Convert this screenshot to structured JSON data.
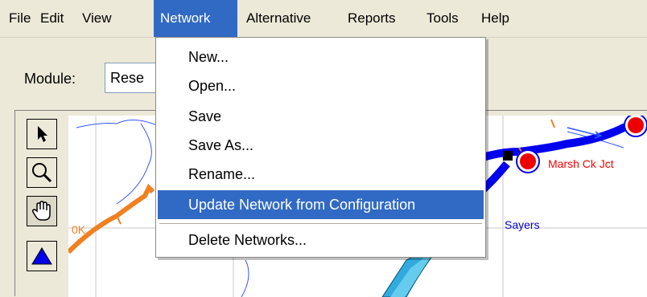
{
  "menubar": {
    "items": [
      {
        "label": "File"
      },
      {
        "label": "Edit"
      },
      {
        "label": "View"
      },
      {
        "label": "Network"
      },
      {
        "label": "Alternative"
      },
      {
        "label": "Reports"
      },
      {
        "label": "Tools"
      },
      {
        "label": "Help"
      }
    ],
    "active": "Network"
  },
  "module": {
    "label": "Module:",
    "value": "Rese"
  },
  "network_menu": {
    "items": [
      {
        "label": "New..."
      },
      {
        "label": "Open..."
      },
      {
        "label": "Save"
      },
      {
        "label": "Save As..."
      },
      {
        "label": "Rename..."
      },
      {
        "label": "Update Network from Configuration"
      },
      {
        "label": "Delete Networks..."
      }
    ],
    "highlighted": "Update Network from Configuration"
  },
  "toolbox": {
    "tools": [
      {
        "icon": "arrow-pointer-icon"
      },
      {
        "icon": "magnifier-icon"
      },
      {
        "icon": "hand-pan-icon"
      },
      {
        "icon": "blue-triangle-icon"
      }
    ]
  },
  "map": {
    "labels": {
      "marsh_ck_jct": "Marsh Ck Jct",
      "sayers": "Sayers",
      "partial_left": "0K"
    },
    "colors": {
      "river": "#0000ff",
      "junction": "#ff0000",
      "reach_orange": "#f08020",
      "label_red": "#ff0000",
      "label_blue": "#0000cc"
    }
  },
  "colors": {
    "menu_highlight": "#316ac5",
    "chrome": "#ece9d8"
  }
}
